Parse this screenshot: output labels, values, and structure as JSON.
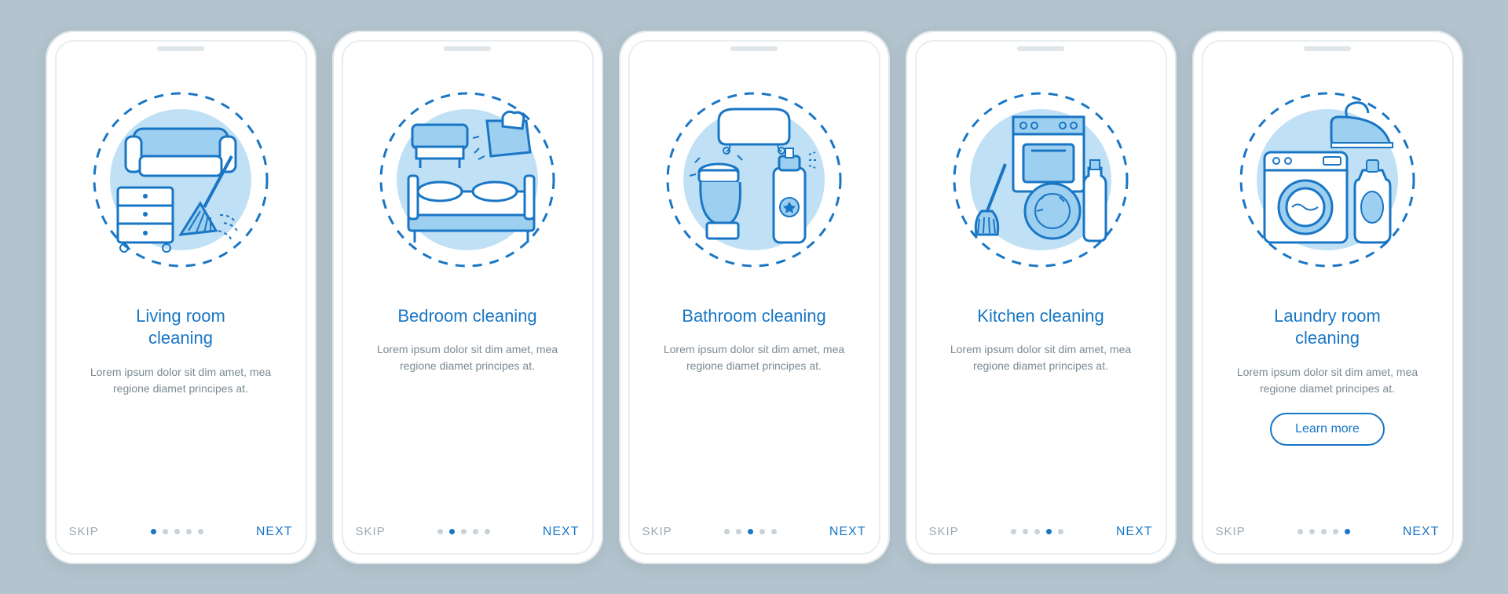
{
  "common": {
    "skip_label": "SKIP",
    "next_label": "NEXT",
    "learn_more_label": "Learn more",
    "total_pages": 5
  },
  "screens": [
    {
      "title": "Living room cleaning",
      "desc": "Lorem ipsum dolor sit dim amet, mea regione diamet principes at.",
      "active_index": 0,
      "icon": "living-room-icon",
      "has_learn_more": false
    },
    {
      "title": "Bedroom cleaning",
      "desc": "Lorem ipsum dolor sit dim amet, mea regione diamet principes at.",
      "active_index": 1,
      "icon": "bedroom-icon",
      "has_learn_more": false
    },
    {
      "title": "Bathroom cleaning",
      "desc": "Lorem ipsum dolor sit dim amet, mea regione diamet principes at.",
      "active_index": 2,
      "icon": "bathroom-icon",
      "has_learn_more": false
    },
    {
      "title": "Kitchen cleaning",
      "desc": "Lorem ipsum dolor sit dim amet, mea regione diamet principes at.",
      "active_index": 3,
      "icon": "kitchen-icon",
      "has_learn_more": false
    },
    {
      "title": "Laundry room cleaning",
      "desc": "Lorem ipsum dolor sit dim amet, mea regione diamet principes at.",
      "active_index": 4,
      "icon": "laundry-icon",
      "has_learn_more": true
    }
  ],
  "colors": {
    "primary": "#1976c5",
    "light_blue": "#9dcff0",
    "bg_blue": "#bfe0f5",
    "grey": "#9aa8b0",
    "page_bg": "#b3c4ce"
  }
}
